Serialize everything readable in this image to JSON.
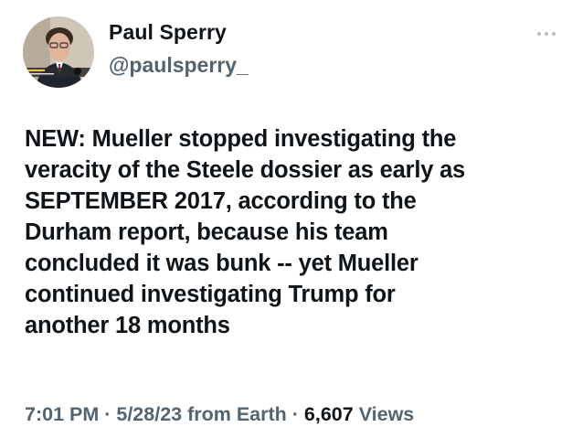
{
  "author": {
    "display_name": "Paul Sperry",
    "handle": "@paulsperry_"
  },
  "tweet": {
    "text": "NEW: Mueller stopped investigating the\nveracity of the Steele dossier as early as\nSEPTEMBER 2017, according to the\nDurham report, because his team\nconcluded it was bunk -- yet Mueller\ncontinued investigating Trump for\nanother 18 months"
  },
  "meta": {
    "time": "7:01 PM",
    "sep1": " · ",
    "date": "5/28/23",
    "source": " from Earth",
    "sep2": " · ",
    "views_count": "6,607",
    "views_label": " Views"
  },
  "icons": {
    "more": "more-horizontal-icon"
  },
  "colors": {
    "text": "#0f1419",
    "secondary": "#536471",
    "background": "#ffffff"
  }
}
